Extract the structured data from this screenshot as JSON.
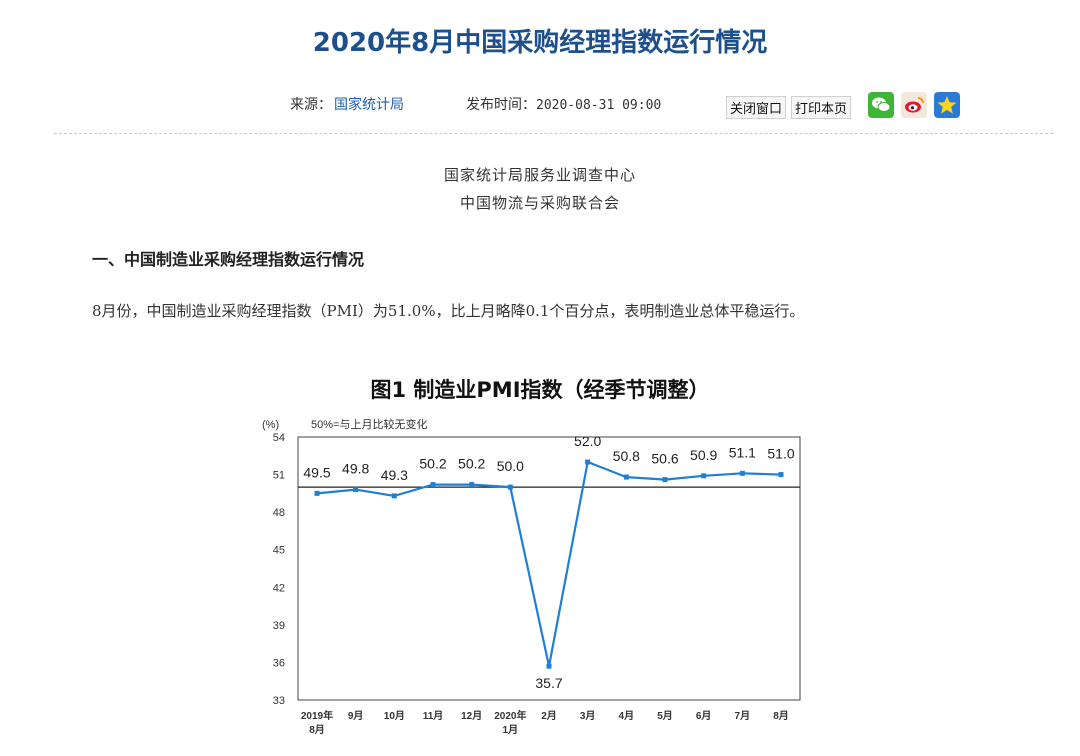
{
  "page": {
    "title": "2020年8月中国采购经理指数运行情况"
  },
  "meta": {
    "source_label": "来源：",
    "source_value": "国家统计局",
    "time_label": "发布时间：",
    "time_value": "2020-08-31 09:00",
    "close_label": "关闭窗口",
    "print_label": "打印本页"
  },
  "share": [
    "wechat-icon",
    "weibo-icon",
    "qzone-icon"
  ],
  "orgs": [
    "国家统计局服务业调查中心",
    "中国物流与采购联合会"
  ],
  "section_heading": "一、中国制造业采购经理指数运行情况",
  "paragraph": "8月份，中国制造业采购经理指数（PMI）为51.0%，比上月略降0.1个百分点，表明制造业总体平稳运行。",
  "figure_title": "图1  制造业PMI指数（经季节调整）",
  "colors": {
    "title": "#1d4f8c",
    "link": "#1d5fa8",
    "series": "#1f7fd6"
  },
  "chart_data": {
    "type": "line",
    "unit_label": "(%)",
    "note": "50%=与上月比较无变化",
    "categories": [
      [
        "2019年",
        "8月"
      ],
      [
        "9月"
      ],
      [
        "10月"
      ],
      [
        "11月"
      ],
      [
        "12月"
      ],
      [
        "2020年",
        "1月"
      ],
      [
        "2月"
      ],
      [
        "3月"
      ],
      [
        "4月"
      ],
      [
        "5月"
      ],
      [
        "6月"
      ],
      [
        "7月"
      ],
      [
        "8月"
      ]
    ],
    "values": [
      49.5,
      49.8,
      49.3,
      50.2,
      50.2,
      50.0,
      35.7,
      52.0,
      50.8,
      50.6,
      50.9,
      51.1,
      51.0
    ],
    "labels": [
      "49.5",
      "49.8",
      "49.3",
      "50.2",
      "50.2",
      "50.0",
      "35.7",
      "52.0",
      "50.8",
      "50.6",
      "50.9",
      "51.1",
      "51.0"
    ],
    "yticks": [
      54,
      51,
      48,
      45,
      42,
      39,
      36,
      33
    ],
    "ylim": [
      33,
      54
    ],
    "reference_line": 50,
    "grid": false
  }
}
